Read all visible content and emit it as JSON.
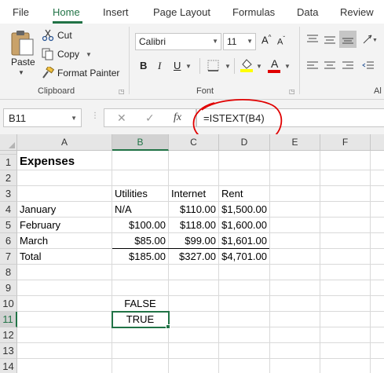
{
  "ribbon": {
    "tabs": [
      "File",
      "Home",
      "Insert",
      "Page Layout",
      "Formulas",
      "Data",
      "Review"
    ],
    "active_tab": "Home",
    "clipboard": {
      "paste_label": "Paste",
      "cut_label": "Cut",
      "copy_label": "Copy",
      "format_painter_label": "Format Painter",
      "group_label": "Clipboard"
    },
    "font": {
      "font_name": "Calibri",
      "font_size": "11",
      "grow_label": "A",
      "shrink_label": "A",
      "bold_label": "B",
      "italic_label": "I",
      "underline_label": "U",
      "font_color_label": "A",
      "group_label": "Font"
    },
    "alignment": {
      "group_label": "Al"
    }
  },
  "formula_bar": {
    "name_box": "B11",
    "cancel_symbol": "✕",
    "enter_symbol": "✓",
    "fx_label": "fx",
    "formula": "=ISTEXT(B4)"
  },
  "columns": [
    "A",
    "B",
    "C",
    "D",
    "E",
    "F"
  ],
  "selected_column": "B",
  "rows": [
    "1",
    "2",
    "3",
    "4",
    "5",
    "6",
    "7",
    "8",
    "9",
    "10",
    "11",
    "12",
    "13",
    "14"
  ],
  "selected_row": "11",
  "sheet": {
    "title": "Expenses",
    "headers": [
      "Utilities",
      "Internet",
      "Rent"
    ],
    "data_rows": [
      {
        "label": "January",
        "utilities": "N/A",
        "internet": "$110.00",
        "rent": "$1,500.00"
      },
      {
        "label": "February",
        "utilities": "$100.00",
        "internet": "$118.00",
        "rent": "$1,600.00"
      },
      {
        "label": "March",
        "utilities": "$85.00",
        "internet": "$99.00",
        "rent": "$1,601.00"
      },
      {
        "label": "Total",
        "utilities": "$185.00",
        "internet": "$327.00",
        "rent": "$4,701.00"
      }
    ],
    "b10": "FALSE",
    "b11": "TRUE"
  },
  "colors": {
    "accent": "#217346",
    "annotation": "#e00000",
    "fill_color_swatch": "#ffff00",
    "font_color_swatch": "#e00000"
  }
}
